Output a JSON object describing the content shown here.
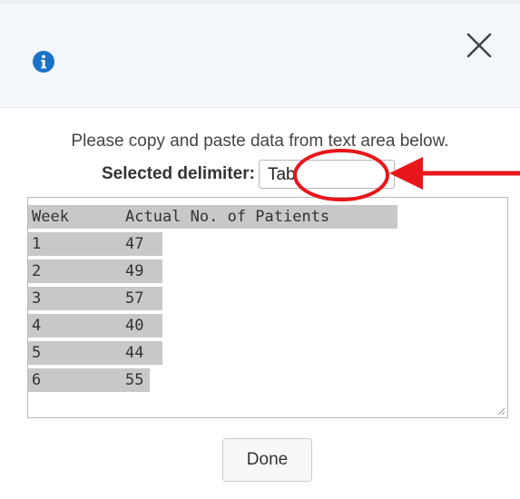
{
  "header": {
    "info_icon": "info-circle-icon",
    "close_icon": "close-x-icon"
  },
  "instructions": "Please copy and paste data from text area below.",
  "delimiter": {
    "label": "Selected delimiter:",
    "value": "Tab"
  },
  "table": {
    "header": [
      "Week",
      "Actual No. of Patients"
    ],
    "rows": [
      [
        "1",
        "47"
      ],
      [
        "2",
        "49"
      ],
      [
        "3",
        "57"
      ],
      [
        "4",
        "40"
      ],
      [
        "5",
        "44"
      ],
      [
        "6",
        "55"
      ]
    ]
  },
  "done_button": "Done",
  "colors": {
    "header_bg": "#f3f7fb",
    "info_icon": "#1a73c8",
    "annotation": "#e8161b",
    "selection": "#c8c8c8"
  }
}
